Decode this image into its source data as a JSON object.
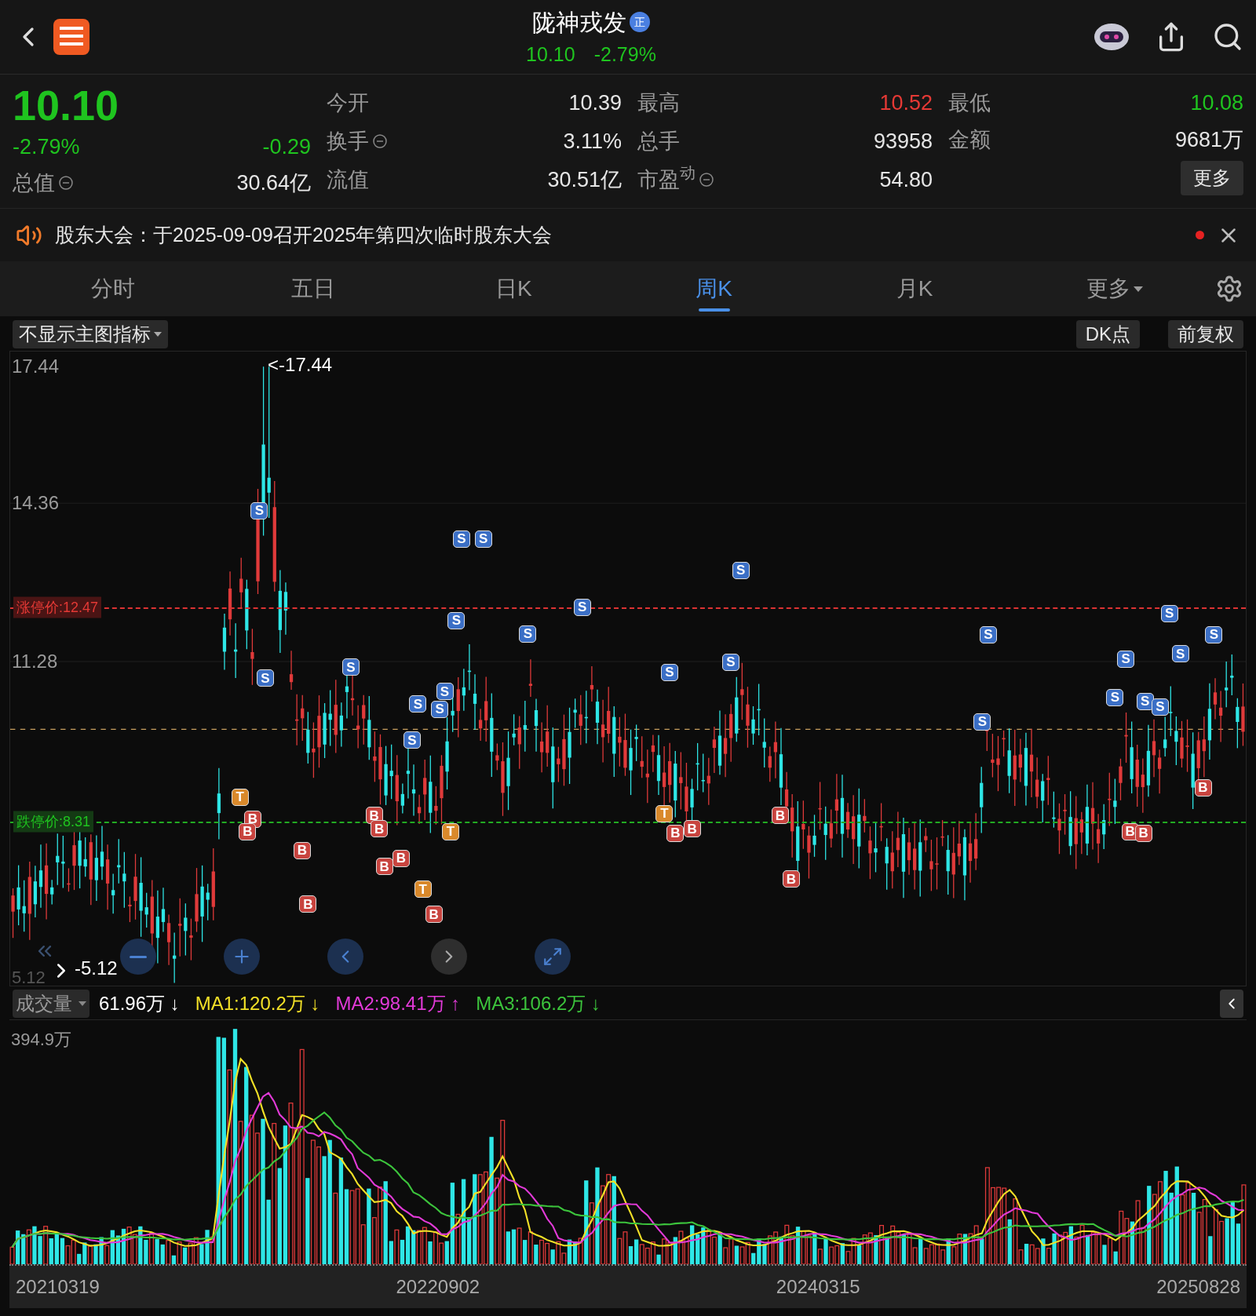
{
  "header": {
    "title": "陇神戎发",
    "badge": "正",
    "price": "10.10",
    "change": "-2.79%"
  },
  "quote": {
    "price": "10.10",
    "change_pct": "-2.79%",
    "change": "-0.29",
    "total_cap_label": "总值",
    "total_cap": "30.64亿",
    "stats": [
      {
        "label": "今开",
        "value": "10.39",
        "kind": "neutral",
        "info": false
      },
      {
        "label": "最高",
        "value": "10.52",
        "kind": "up",
        "info": false
      },
      {
        "label": "最低",
        "value": "10.08",
        "kind": "down",
        "info": false
      },
      {
        "label": "换手",
        "value": "3.11%",
        "kind": "neutral",
        "info": true
      },
      {
        "label": "总手",
        "value": "93958",
        "kind": "neutral",
        "info": false
      },
      {
        "label": "金额",
        "value": "9681万",
        "kind": "neutral",
        "info": false
      },
      {
        "label": "流值",
        "value": "30.51亿",
        "kind": "neutral",
        "info": false
      },
      {
        "label": "市盈$^{动}$",
        "value": "54.80",
        "kind": "neutral",
        "info": true
      }
    ],
    "more_button": "更多"
  },
  "notice": {
    "text": "股东大会：于2025-09-09召开2025年第四次临时股东大会",
    "unread": true
  },
  "tabs": [
    {
      "label": "分时",
      "selected": false,
      "kind": "tab"
    },
    {
      "label": "五日",
      "selected": false,
      "kind": "tab"
    },
    {
      "label": "日K",
      "selected": false,
      "kind": "tab"
    },
    {
      "label": "周K",
      "selected": true,
      "kind": "tab"
    },
    {
      "label": "月K",
      "selected": false,
      "kind": "tab"
    },
    {
      "label": "更多",
      "selected": false,
      "kind": "menu"
    }
  ],
  "chart_toolbar": {
    "indicator": "不显示主图指标",
    "dk_button": "DK点",
    "adjust_button": "前复权"
  },
  "kline": {
    "y_labels": [
      "17.44",
      "14.36",
      "11.28"
    ],
    "bottom_label": "5.12",
    "max_marker": "<-17.44",
    "min_marker": "-5.12",
    "price_lines": [
      {
        "label": "涨停价:12.47",
        "kind": "limit_up"
      },
      {
        "label": "跌停价:8.31",
        "kind": "limit_down"
      }
    ],
    "markers": [
      {
        "label": "S",
        "kind": "sell"
      },
      {
        "label": "S",
        "kind": "sell"
      },
      {
        "label": "S",
        "kind": "sell"
      },
      {
        "label": "S",
        "kind": "sell"
      },
      {
        "label": "S",
        "kind": "sell"
      },
      {
        "label": "S",
        "kind": "sell"
      },
      {
        "label": "S",
        "kind": "sell"
      },
      {
        "label": "S",
        "kind": "sell"
      },
      {
        "label": "S",
        "kind": "sell"
      },
      {
        "label": "S",
        "kind": "sell"
      },
      {
        "label": "S",
        "kind": "sell"
      },
      {
        "label": "S",
        "kind": "sell"
      },
      {
        "label": "S",
        "kind": "sell"
      },
      {
        "label": "S",
        "kind": "sell"
      },
      {
        "label": "S",
        "kind": "sell"
      },
      {
        "label": "S",
        "kind": "sell"
      },
      {
        "label": "S",
        "kind": "sell"
      },
      {
        "label": "S",
        "kind": "sell"
      },
      {
        "label": "S",
        "kind": "sell"
      },
      {
        "label": "S",
        "kind": "sell"
      },
      {
        "label": "S",
        "kind": "sell"
      },
      {
        "label": "S",
        "kind": "sell"
      },
      {
        "label": "S",
        "kind": "sell"
      },
      {
        "label": "S",
        "kind": "sell"
      },
      {
        "label": "B",
        "kind": "buy"
      },
      {
        "label": "B",
        "kind": "buy"
      },
      {
        "label": "B",
        "kind": "buy"
      },
      {
        "label": "B",
        "kind": "buy"
      },
      {
        "label": "B",
        "kind": "buy"
      },
      {
        "label": "B",
        "kind": "buy"
      },
      {
        "label": "B",
        "kind": "buy"
      },
      {
        "label": "B",
        "kind": "buy"
      },
      {
        "label": "B",
        "kind": "buy"
      },
      {
        "label": "B",
        "kind": "buy"
      },
      {
        "label": "B",
        "kind": "buy"
      },
      {
        "label": "B",
        "kind": "buy"
      },
      {
        "label": "B",
        "kind": "buy"
      },
      {
        "label": "B",
        "kind": "buy"
      },
      {
        "label": "B",
        "kind": "buy"
      },
      {
        "label": "B",
        "kind": "buy"
      },
      {
        "label": "T",
        "kind": "t"
      },
      {
        "label": "T",
        "kind": "t"
      },
      {
        "label": "T",
        "kind": "t"
      },
      {
        "label": "T",
        "kind": "t"
      }
    ]
  },
  "volume": {
    "selector": "成交量",
    "legend": [
      {
        "text": "61.96万 ↓",
        "kind": "vol"
      },
      {
        "text": "MA1:120.2万 ↓",
        "kind": "ma1"
      },
      {
        "text": "MA2:98.41万 ↑",
        "kind": "ma2"
      },
      {
        "text": "MA3:106.2万 ↓",
        "kind": "ma3"
      }
    ],
    "max_label": "394.9万"
  },
  "x_axis": [
    "20210319",
    "20220902",
    "20240315",
    "20250828"
  ]
}
